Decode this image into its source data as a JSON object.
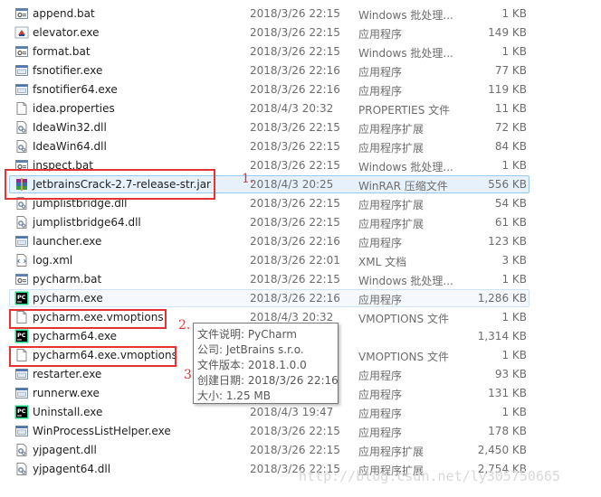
{
  "files": [
    {
      "name": "append.bat",
      "date": "2018/3/26 22:15",
      "type": "Windows 批处理...",
      "size": "1 KB",
      "icon": "bat-file-icon"
    },
    {
      "name": "elevator.exe",
      "date": "2018/3/26 22:15",
      "type": "应用程序",
      "size": "149 KB",
      "icon": "elevator-app-icon"
    },
    {
      "name": "format.bat",
      "date": "2018/3/26 22:15",
      "type": "Windows 批处理...",
      "size": "1 KB",
      "icon": "bat-file-icon"
    },
    {
      "name": "fsnotifier.exe",
      "date": "2018/3/26 22:16",
      "type": "应用程序",
      "size": "77 KB",
      "icon": "exe-file-icon"
    },
    {
      "name": "fsnotifier64.exe",
      "date": "2018/3/26 22:16",
      "type": "应用程序",
      "size": "119 KB",
      "icon": "exe-file-icon"
    },
    {
      "name": "idea.properties",
      "date": "2018/4/3 20:32",
      "type": "PROPERTIES 文件",
      "size": "11 KB",
      "icon": "blank-file-icon"
    },
    {
      "name": "IdeaWin32.dll",
      "date": "2018/3/26 22:15",
      "type": "应用程序扩展",
      "size": "72 KB",
      "icon": "dll-file-icon"
    },
    {
      "name": "IdeaWin64.dll",
      "date": "2018/3/26 22:15",
      "type": "应用程序扩展",
      "size": "84 KB",
      "icon": "dll-file-icon"
    },
    {
      "name": "inspect.bat",
      "date": "2018/3/26 22:15",
      "type": "Windows 批处理...",
      "size": "1 KB",
      "icon": "bat-file-icon"
    },
    {
      "name": "JetbrainsCrack-2.7-release-str.jar",
      "date": "2018/4/3 20:25",
      "type": "WinRAR 压缩文件",
      "size": "556 KB",
      "icon": "winrar-archive-icon",
      "selected": true
    },
    {
      "name": "jumplistbridge.dll",
      "date": "2018/3/26 22:15",
      "type": "应用程序扩展",
      "size": "54 KB",
      "icon": "dll-file-icon"
    },
    {
      "name": "jumplistbridge64.dll",
      "date": "2018/3/26 22:15",
      "type": "应用程序扩展",
      "size": "61 KB",
      "icon": "dll-file-icon"
    },
    {
      "name": "launcher.exe",
      "date": "2018/3/26 22:16",
      "type": "应用程序",
      "size": "123 KB",
      "icon": "exe-file-icon"
    },
    {
      "name": "log.xml",
      "date": "2018/3/26 22:01",
      "type": "XML 文档",
      "size": "3 KB",
      "icon": "xml-file-icon"
    },
    {
      "name": "pycharm.bat",
      "date": "2018/3/26 22:15",
      "type": "Windows 批处理...",
      "size": "1 KB",
      "icon": "bat-file-icon"
    },
    {
      "name": "pycharm.exe",
      "date": "2018/3/26 22:16",
      "type": "应用程序",
      "size": "1,286 KB",
      "icon": "pycharm-app-icon",
      "hover": true
    },
    {
      "name": "pycharm.exe.vmoptions",
      "date": "2018/4/3 20:32",
      "type": "VMOPTIONS 文件",
      "size": "1 KB",
      "icon": "blank-file-icon"
    },
    {
      "name": "pycharm64.exe",
      "date": "",
      "type": "",
      "size": "1,314 KB",
      "icon": "pycharm-app-icon"
    },
    {
      "name": "pycharm64.exe.vmoptions",
      "date": "",
      "type": "VMOPTIONS 文件",
      "size": "1 KB",
      "icon": "blank-file-icon"
    },
    {
      "name": "restarter.exe",
      "date": "",
      "type": "应用程序",
      "size": "93 KB",
      "icon": "exe-file-icon"
    },
    {
      "name": "runnerw.exe",
      "date": "",
      "type": "应用程序",
      "size": "131 KB",
      "icon": "exe-file-icon"
    },
    {
      "name": "Uninstall.exe",
      "date": "2018/4/3 19:47",
      "type": "应用程序",
      "size": "1 KB",
      "icon": "pycharm-app-icon"
    },
    {
      "name": "WinProcessListHelper.exe",
      "date": "2018/3/26 22:15",
      "type": "应用程序",
      "size": "178 KB",
      "icon": "exe-file-icon"
    },
    {
      "name": "yjpagent.dll",
      "date": "2018/3/26 22:15",
      "type": "应用程序扩展",
      "size": "2,450 KB",
      "icon": "dll-file-icon"
    },
    {
      "name": "yjpagent64.dll",
      "date": "2018/3/26 22:15",
      "type": "应用程序扩展",
      "size": "2,754 KB",
      "icon": "dll-file-icon"
    }
  ],
  "annotations": {
    "label_1": "1.",
    "label_2": "2.",
    "label_3": "3."
  },
  "tooltip": {
    "description": "文件说明: PyCharm",
    "company": "公司: JetBrains s.r.o.",
    "version": "文件版本: 2018.1.0.0",
    "created": "创建日期: 2018/3/26 22:16",
    "size": "大小: 1.25 MB"
  },
  "watermark": "http://blog.csdn.net/ly305750665",
  "colors": {
    "annotation_red": "#e53232",
    "selection_fill": "#e6f1fb",
    "selection_border": "#99c9ef"
  }
}
